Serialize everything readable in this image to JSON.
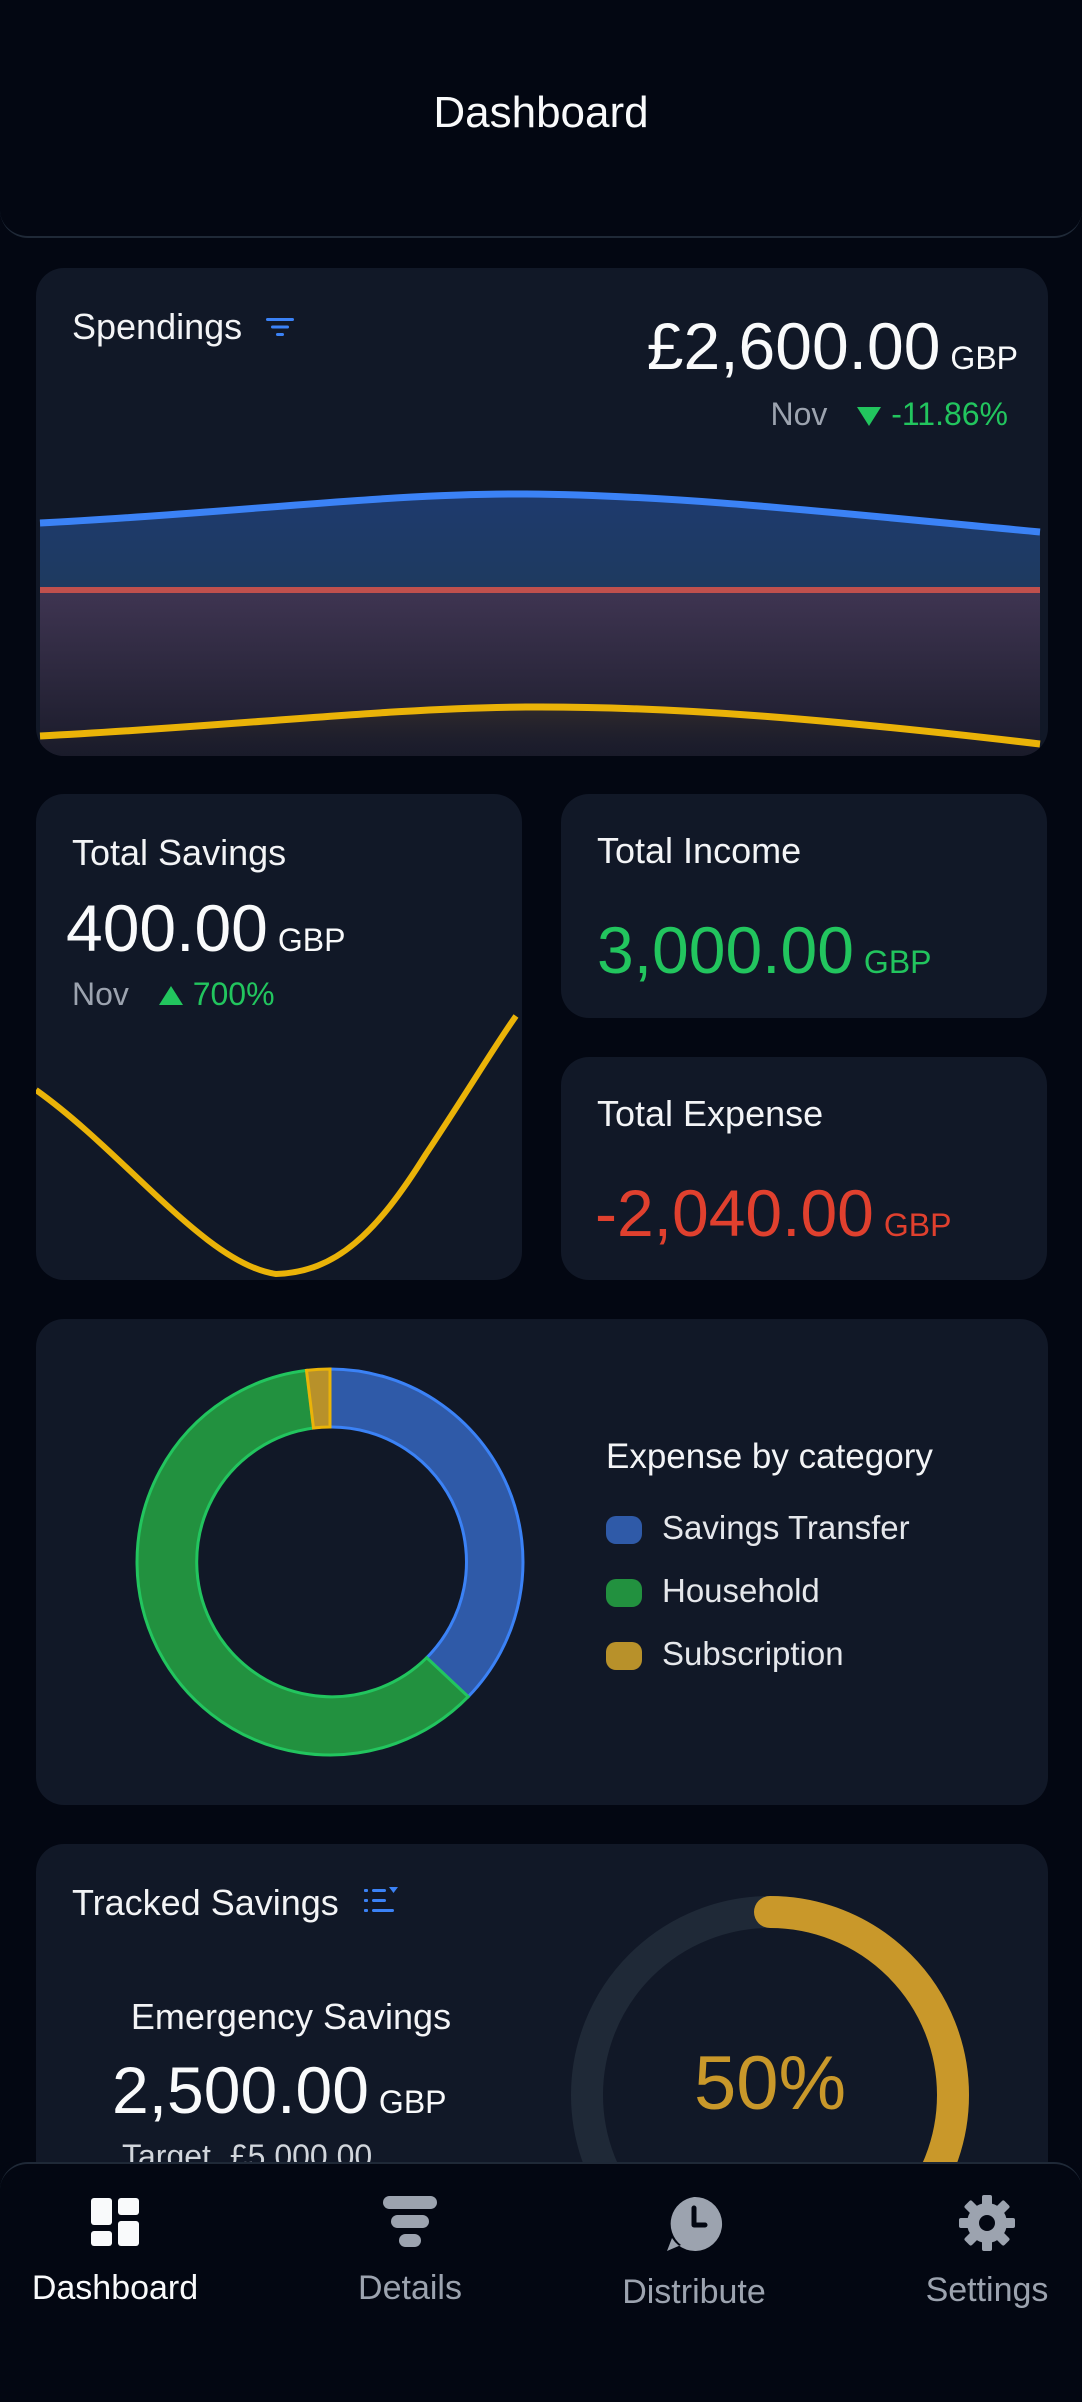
{
  "header": {
    "title": "Dashboard"
  },
  "spendings": {
    "title": "Spendings",
    "filter_icon": "filter-lines-icon",
    "amount": "£2,600.00",
    "currency": "GBP",
    "month": "Nov",
    "change": "-11.86%",
    "change_direction": "down",
    "change_color": "#22c55e"
  },
  "savings": {
    "title": "Total Savings",
    "amount": "400.00",
    "currency": "GBP",
    "month": "Nov",
    "change": "700%",
    "change_direction": "up",
    "line_color": "#eab308"
  },
  "income": {
    "title": "Total Income",
    "amount": "3,000.00",
    "currency": "GBP",
    "color": "#22c55e"
  },
  "expense": {
    "title": "Total Expense",
    "amount": "-2,040.00",
    "currency": "GBP",
    "color": "#e0402e"
  },
  "categories": {
    "title": "Expense by category",
    "items": [
      {
        "label": "Savings Transfer",
        "color": "#2f5aa8"
      },
      {
        "label": "Household",
        "color": "#22913f"
      },
      {
        "label": "Subscription",
        "color": "#b8912a"
      }
    ]
  },
  "tracked": {
    "title": "Tracked Savings",
    "sort_icon": "sort-list-icon",
    "goal_name": "Emergency Savings",
    "amount": "2,500.00",
    "currency": "GBP",
    "target_label": "Target",
    "target_value": "£5,000.00",
    "progress_label": "50%",
    "progress": 0.5,
    "progress_color": "#c9982a"
  },
  "nav": {
    "items": [
      {
        "label": "Dashboard",
        "icon": "dashboard-grid-icon",
        "active": true
      },
      {
        "label": "Details",
        "icon": "layers-stack-icon",
        "active": false
      },
      {
        "label": "Distribute",
        "icon": "clock-bubble-icon",
        "active": false
      },
      {
        "label": "Settings",
        "icon": "gear-icon",
        "active": false
      }
    ]
  }
}
